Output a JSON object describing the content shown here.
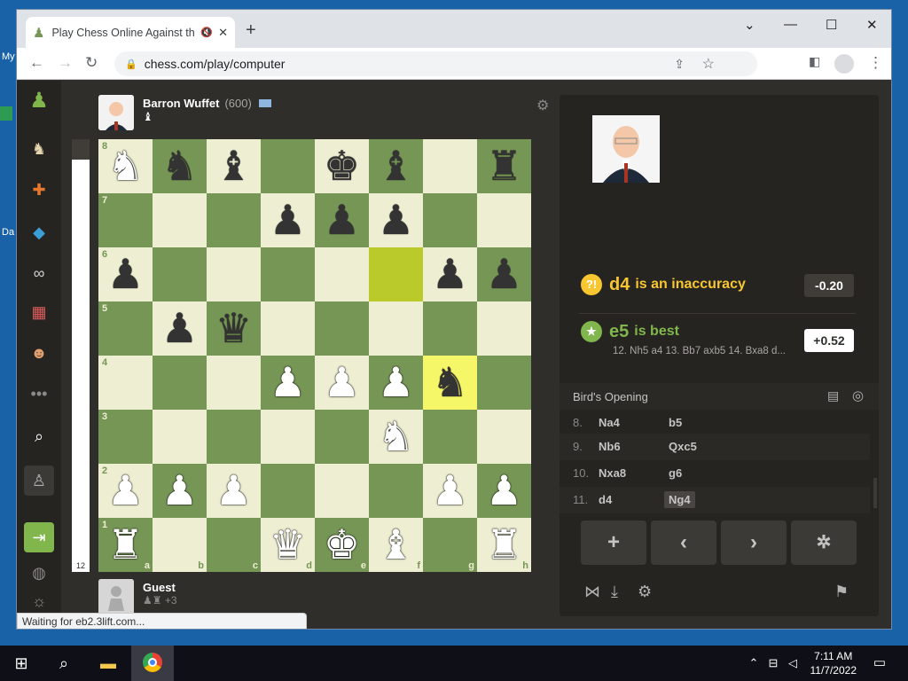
{
  "desktop": {
    "frag_top": "My",
    "frag_mid": "Da"
  },
  "browser": {
    "tab_title": "Play Chess Online Against th",
    "tab_audio": "🔇",
    "url": "chess.com/play/computer",
    "status": "Waiting for eb2.3lift.com..."
  },
  "top_player": {
    "name": "Barron Wuffet",
    "rating": "(600)",
    "captured": "♝"
  },
  "bottom_player": {
    "name": "Guest",
    "captured": "♟♜",
    "advantage": "+3"
  },
  "eval_number": "12",
  "board": {
    "ranks": [
      "8",
      "7",
      "6",
      "5",
      "4",
      "3",
      "2",
      "1"
    ],
    "files": [
      "a",
      "b",
      "c",
      "d",
      "e",
      "f",
      "g",
      "h"
    ],
    "position": [
      [
        "wN",
        "bN",
        "bB",
        "",
        "bK",
        "bB",
        "",
        "bR"
      ],
      [
        "",
        "",
        "",
        "bP",
        "bP",
        "bP",
        "",
        ""
      ],
      [
        "bP",
        "",
        "",
        "",
        "",
        "",
        "bP",
        "bP"
      ],
      [
        "",
        "bP",
        "bQ",
        "",
        "",
        "",
        "",
        ""
      ],
      [
        "",
        "",
        "",
        "wP",
        "wP",
        "wP",
        "bN",
        ""
      ],
      [
        "",
        "",
        "",
        "",
        "",
        "wN",
        "",
        ""
      ],
      [
        "wP",
        "wP",
        "wP",
        "",
        "",
        "",
        "wP",
        "wP"
      ],
      [
        "wR",
        "",
        "",
        "wQ",
        "wK",
        "wB",
        "",
        "wR"
      ]
    ],
    "highlights": [
      {
        "rank": 6,
        "file": "f"
      },
      {
        "rank": 4,
        "file": "g"
      }
    ]
  },
  "analysis": {
    "mistake_symbol": "?!",
    "mistake_move": "d4",
    "mistake_text": "is an inaccuracy",
    "mistake_score": "-0.20",
    "best_move": "e5",
    "best_text": "is best",
    "best_score": "+0.52",
    "best_line": "12. Nh5 a4 13. Bb7 axb5 14. Bxa8 d..."
  },
  "opening": "Bird's Opening",
  "moves": [
    {
      "num": "8.",
      "white": "Na4",
      "black": "b5"
    },
    {
      "num": "9.",
      "white": "Nb6",
      "black": "Qxc5"
    },
    {
      "num": "10.",
      "white": "Nxa8",
      "black": "g6"
    },
    {
      "num": "11.",
      "white": "d4",
      "black": "Ng4"
    }
  ],
  "taskbar": {
    "time": "7:11 AM",
    "date": "11/7/2022"
  },
  "colors": {
    "light": "#eeeed2",
    "dark": "#769656",
    "inaccuracy": "#f7c631",
    "best": "#81b64c"
  }
}
